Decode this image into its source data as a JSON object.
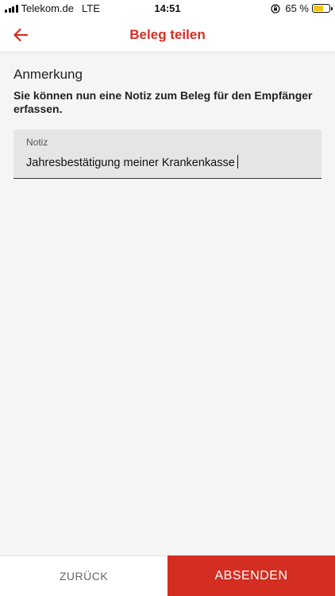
{
  "status_bar": {
    "carrier": "Telekom.de",
    "network": "LTE",
    "time": "14:51",
    "battery_percent": "65 %",
    "battery_level": 0.65,
    "battery_color": "#f3c419",
    "icons": [
      "signal-bars-icon",
      "orientation-lock-icon",
      "battery-icon"
    ]
  },
  "header": {
    "title": "Beleg teilen",
    "back_icon": "arrow-left-icon",
    "accent_color": "#d42d22"
  },
  "content": {
    "section_title": "Anmerkung",
    "description": "Sie können nun eine Notiz zum Beleg für den Empfänger erfassen.",
    "note_field": {
      "label": "Notiz",
      "value": "Jahresbestätigung meiner Krankenkasse"
    }
  },
  "footer": {
    "back_label": "ZURÜCK",
    "send_label": "ABSENDEN"
  }
}
